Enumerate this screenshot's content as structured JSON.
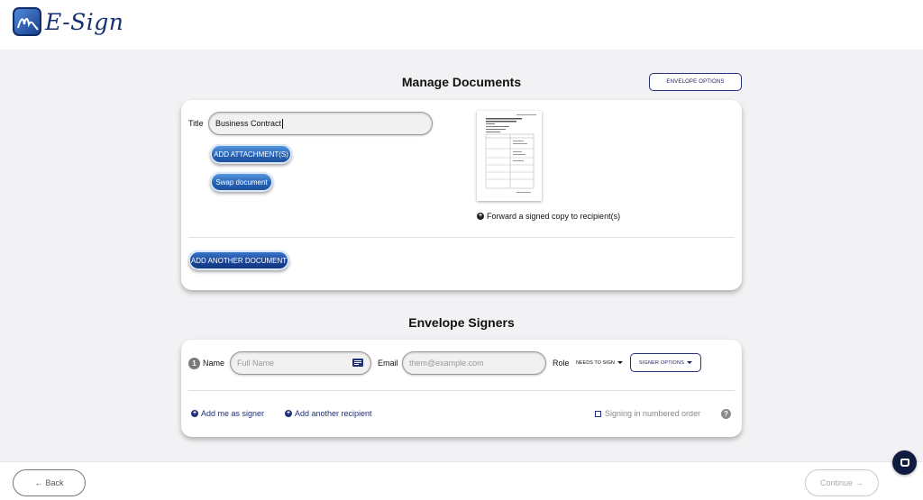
{
  "app": {
    "logo_text": "E-Sign"
  },
  "manage": {
    "title": "Manage Documents",
    "envelope_options_label": "ENVELOPE OPTIONS",
    "document": {
      "title_label": "Title",
      "title_value": "Business Contract",
      "add_attachments_label": "ADD ATTACHMENT(S)",
      "swap_document_label": "Swap document",
      "forward_label": "Forward a signed copy to recipient(s)"
    },
    "add_another_document_label": "ADD ANOTHER DOCUMENT"
  },
  "signers": {
    "title": "Envelope Signers",
    "rows": [
      {
        "number": "1",
        "name_label": "Name",
        "name_placeholder": "Full Name",
        "email_label": "Email",
        "email_placeholder": "them@example.com",
        "role_label": "Role",
        "role_value": "NEEDS TO SIGN",
        "signer_options_label": "SIGNER OPTIONS"
      }
    ],
    "add_me_label": "Add me as signer",
    "add_recipient_label": "Add another recipient",
    "numbered_order_label": "Signing in numbered order",
    "numbered_order_checked": false
  },
  "footer": {
    "back_label": "Back",
    "continue_label": "Continue"
  },
  "icons": {
    "contact_card": "contact-card-icon",
    "help": "help-icon",
    "chat": "chat-icon",
    "arrow_left": "arrow-left-icon",
    "arrow_right": "arrow-right-icon"
  },
  "colors": {
    "brand": "#14306e",
    "button": "#2662b4",
    "link": "#1f2f7a"
  }
}
